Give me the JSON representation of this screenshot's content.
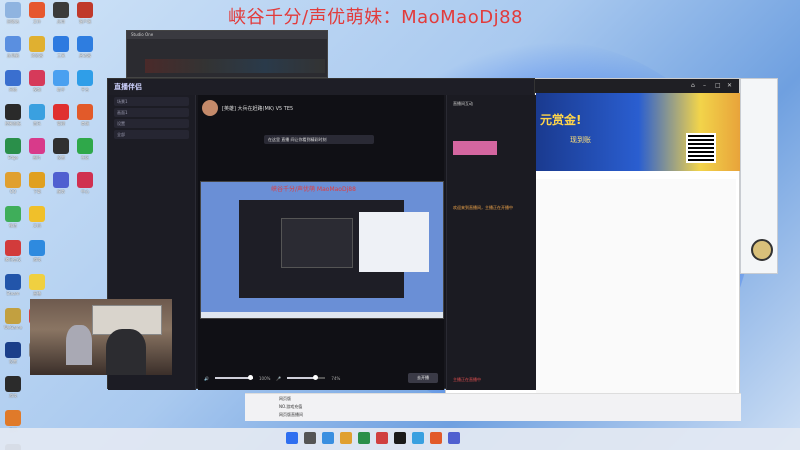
{
  "watermark": "峡谷千分/声优萌妹：MaoMaoDj88",
  "stream_app": {
    "logo": "直播伴侣",
    "room_title": "[英雄] 大兵在赶路(MK) V5 TE5",
    "tip": "在这里 直播 间让你看到精彩时刻",
    "preview_watermark": "峡谷千分/声优萌 MaoMaoDj88",
    "sidebar_rows": [
      "场景1",
      "画面1",
      "设置",
      "全部"
    ],
    "volume_label": "100%",
    "mic_label": "74%",
    "start_button": "去开播",
    "right_panel_title": "直播间互动",
    "notice": "欢迎来到直播间，主播正在开播中",
    "live_text": "主播正在直播中"
  },
  "editor": {
    "title": "Studio One"
  },
  "browser": {
    "banner_text": "元赏金!",
    "banner_sub": "现到账"
  },
  "chatbar": {
    "lines": [
      "网页版",
      "NO.游戏充值",
      "网页版直播间"
    ]
  },
  "taskbar": {
    "time": "",
    "date": ""
  },
  "desktop_icons": {
    "col1": [
      "回收站",
      "此电脑",
      "网络",
      "控制面板",
      "Edge",
      "QQ",
      "微信",
      "腾讯会议",
      "Steam",
      "WeGame",
      "设置",
      "游戏",
      "工具",
      "音乐"
    ],
    "col2": [
      "文件",
      "浏览器",
      "视频",
      "音乐",
      "图片",
      "下载",
      "文档",
      "游戏",
      "直播",
      "录屏",
      "剪辑"
    ],
    "col3": [
      "应用",
      "工具",
      "助手",
      "管理",
      "设置",
      "服务"
    ],
    "col4": [
      "客户端",
      "启动器",
      "平台",
      "商城",
      "社区",
      "中心"
    ]
  },
  "colors": {
    "watermark": "#e23b3b",
    "accent": "#2f6ff0",
    "stream_bg": "#17171d"
  }
}
